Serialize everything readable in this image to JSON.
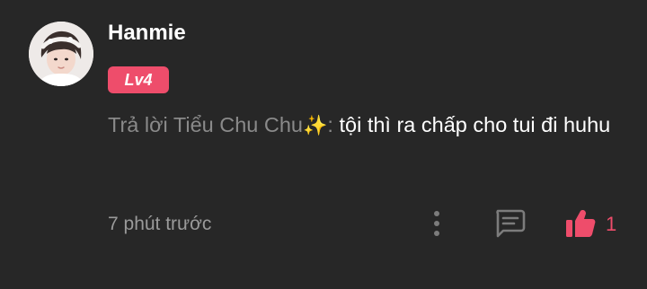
{
  "comment": {
    "author": {
      "name": "Hanmie",
      "level_badge": "Lv4"
    },
    "reply_prefix": "Trả lời ",
    "reply_target": "Tiểu Chu Chu",
    "reply_target_emoji": "✨",
    "reply_separator": ": ",
    "message": "tội thì ra chấp cho tui đi huhu",
    "timestamp": "7 phút trước",
    "like_count": "1"
  },
  "icons": {
    "more": "vertical-ellipsis-icon",
    "reply": "chat-bubble-icon",
    "like": "thumbs-up-icon"
  },
  "colors": {
    "background": "#272727",
    "accent": "#ee4d6b",
    "muted_text": "#8a8a8a",
    "icon": "#7c7c7c"
  }
}
